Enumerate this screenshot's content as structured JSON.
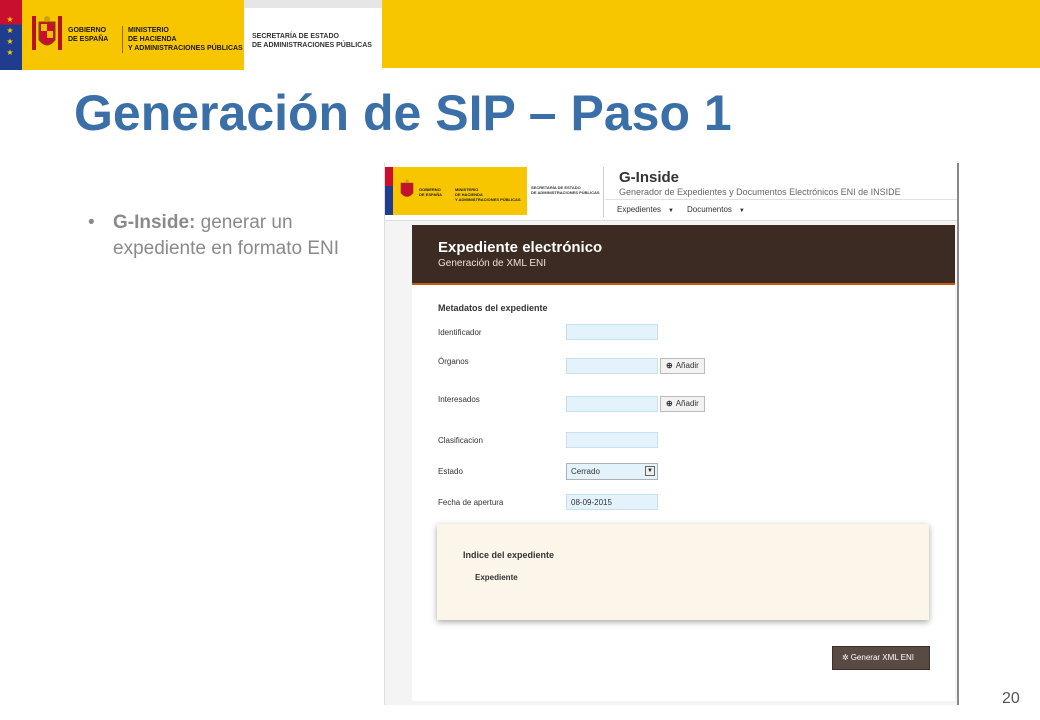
{
  "header": {
    "gov_line1": "GOBIERNO",
    "gov_line2": "DE ESPAÑA",
    "min_line1": "MINISTERIO",
    "min_line2": "DE HACIENDA",
    "min_line3": "Y ADMINISTRACIONES PÚBLICAS",
    "sec_line1": "SECRETARÍA DE ESTADO",
    "sec_line2": "DE ADMINISTRACIONES PÚBLICAS",
    "colors": {
      "yellow": "#f7c600",
      "title_blue": "#3b6fa8"
    }
  },
  "slide": {
    "title": "Generación de SIP – Paso 1",
    "bullet_bold": "G-Inside:",
    "bullet_text": " generar un expediente en formato ENI",
    "page_number": "20"
  },
  "app": {
    "name": "G-Inside",
    "subtitle": "Generador de Expedientes y Documentos Electrónicos ENI de INSIDE",
    "nav": [
      {
        "label": "Expedientes"
      },
      {
        "label": "Documentos"
      }
    ],
    "panel_title": "Expediente electrónico",
    "panel_subtitle": "Generación de XML ENI",
    "section_title": "Metadatos del expediente",
    "fields": {
      "identificador": {
        "label": "Identificador",
        "value": ""
      },
      "organos": {
        "label": "Órganos",
        "value": ""
      },
      "interesados": {
        "label": "Interesados",
        "value": ""
      },
      "clasificacion": {
        "label": "Clasificacion",
        "value": ""
      },
      "estado": {
        "label": "Estado",
        "value": "Cerrado"
      },
      "fecha": {
        "label": "Fecha de apertura",
        "value": "08-09-2015"
      }
    },
    "add_label": "Añadir",
    "index_title": "Indice del expediente",
    "index_item": "Expediente",
    "generate_label": "Generar XML ENI"
  }
}
